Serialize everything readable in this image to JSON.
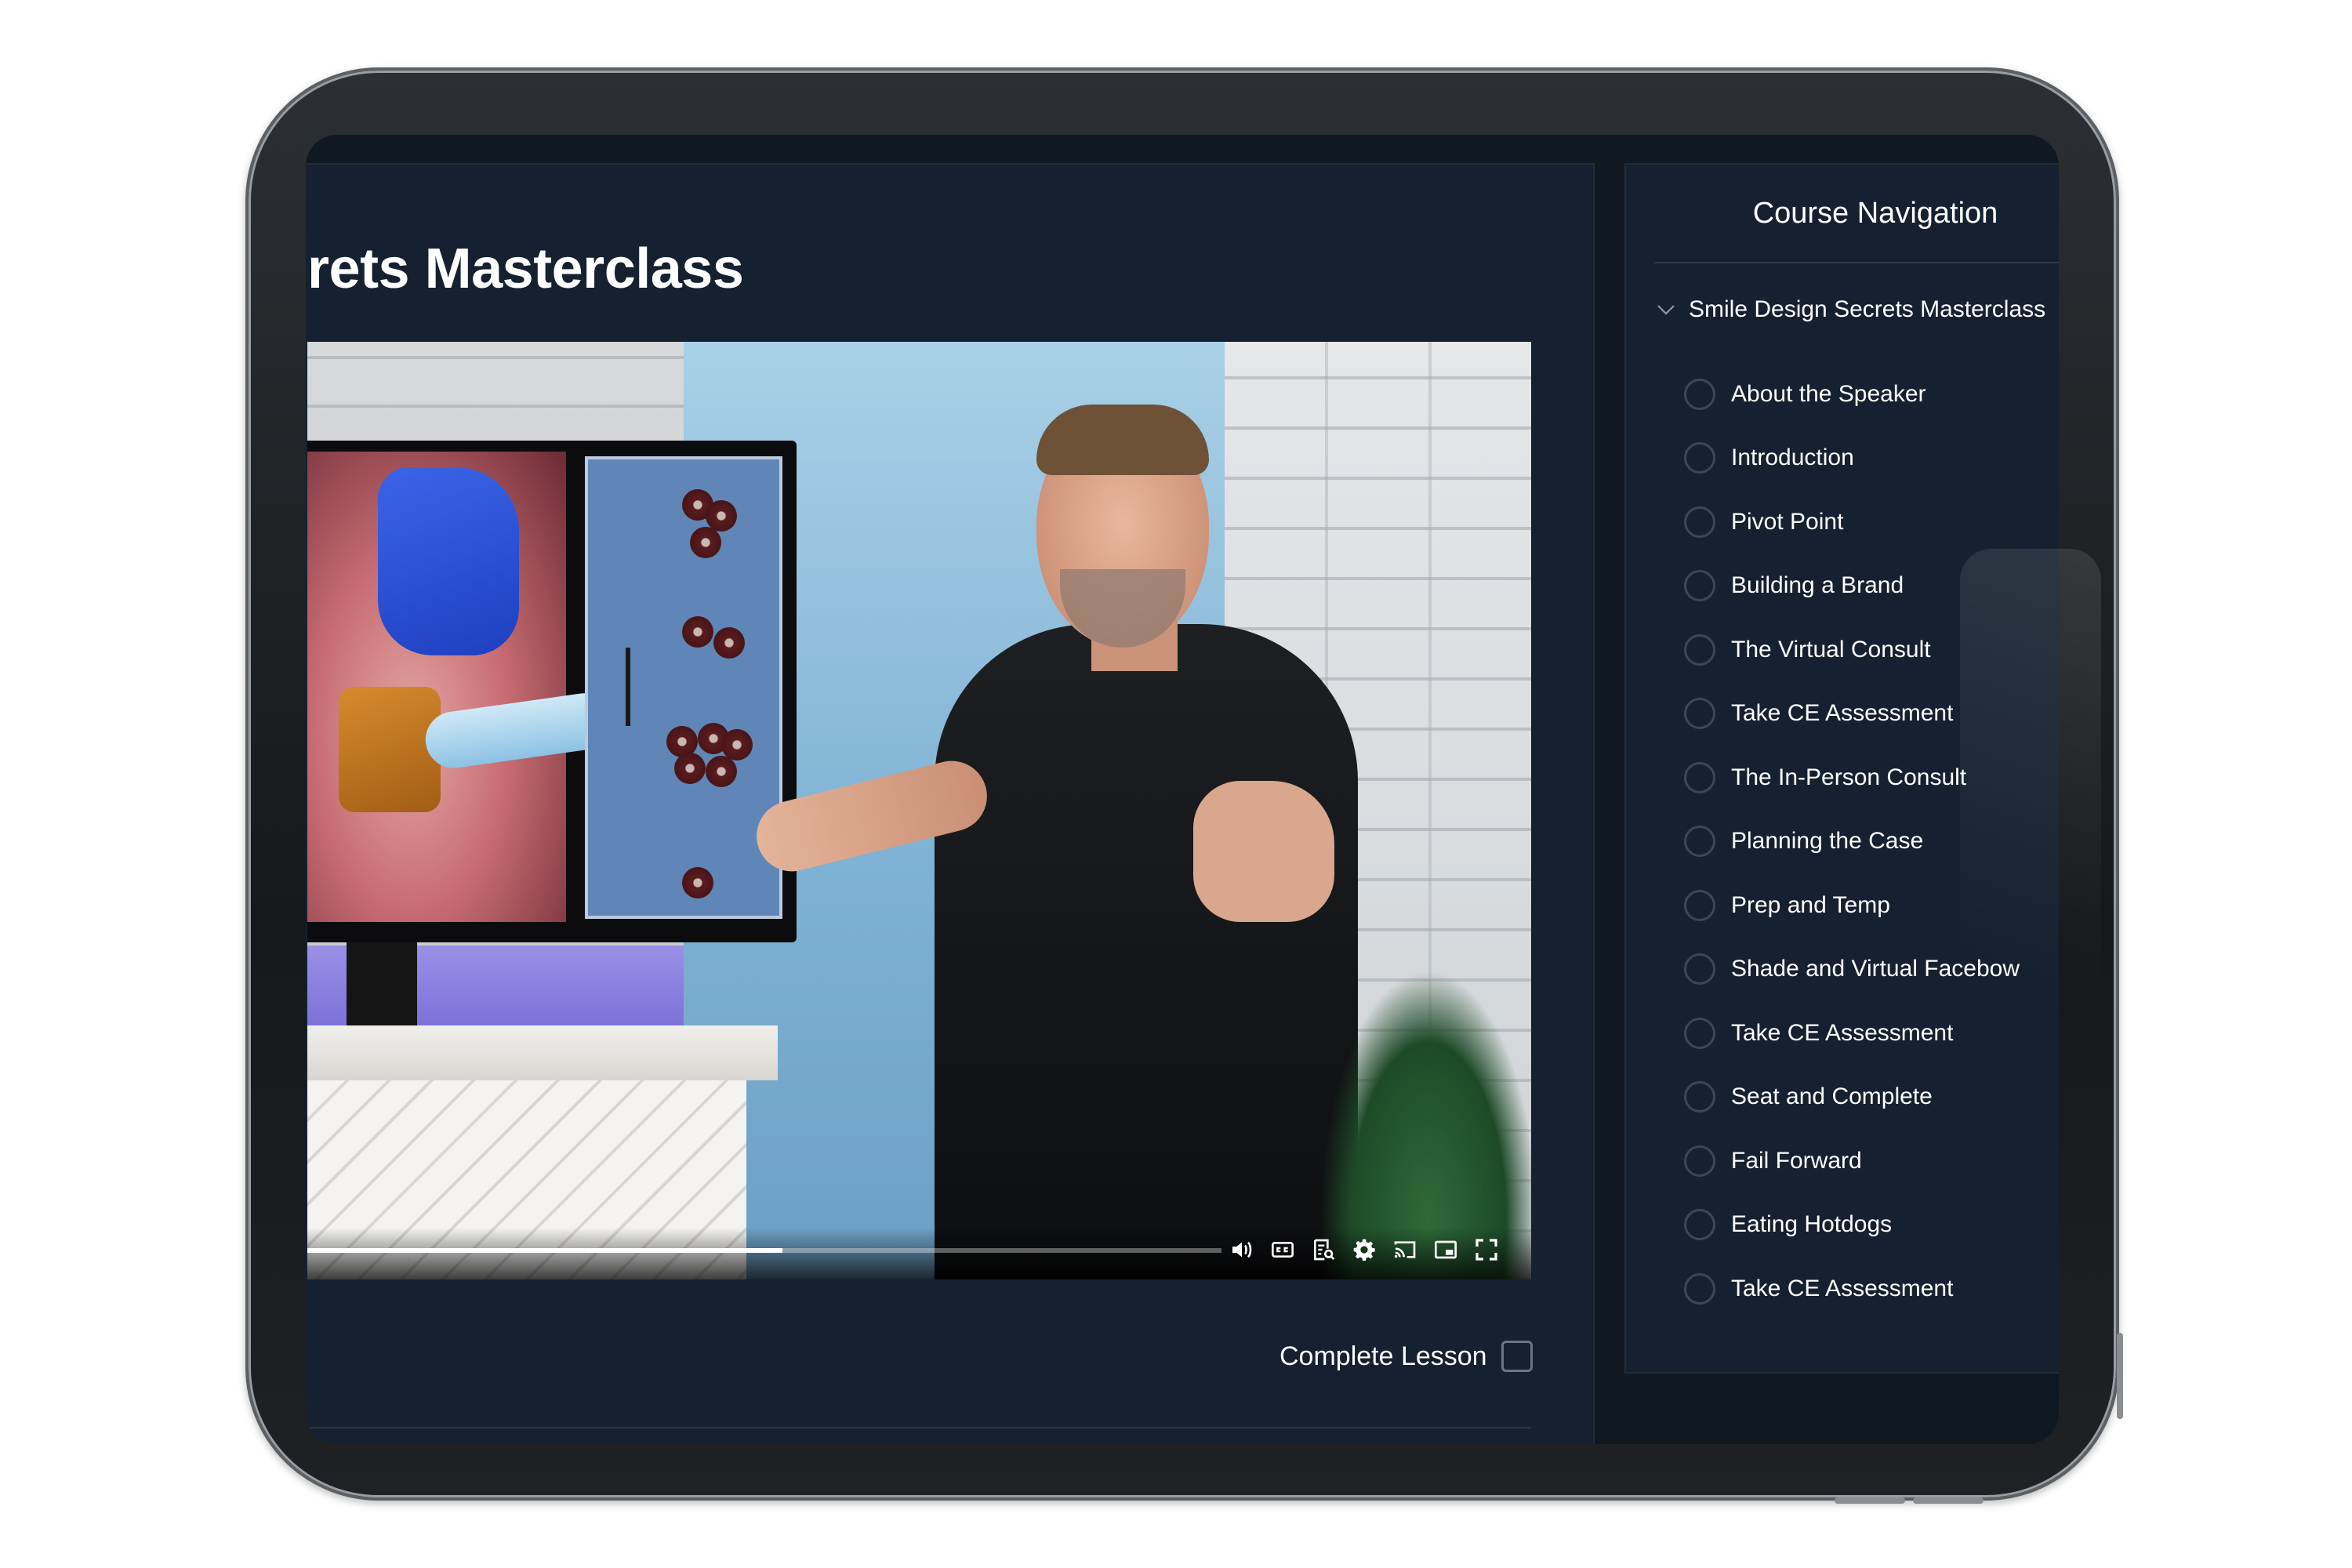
{
  "page": {
    "title": "rets Masterclass"
  },
  "video": {
    "progress_fraction": 0.52,
    "controls": [
      {
        "name": "volume-icon"
      },
      {
        "name": "captions-icon"
      },
      {
        "name": "transcript-icon"
      },
      {
        "name": "settings-icon"
      },
      {
        "name": "cast-icon"
      },
      {
        "name": "picture-in-picture-icon"
      },
      {
        "name": "fullscreen-icon"
      }
    ]
  },
  "lesson": {
    "complete_label": "Complete Lesson"
  },
  "nav": {
    "title": "Course Navigation",
    "section_label": "Smile Design Secrets Masterclass",
    "items": [
      {
        "label": "About the Speaker"
      },
      {
        "label": "Introduction"
      },
      {
        "label": "Pivot Point"
      },
      {
        "label": "Building a Brand"
      },
      {
        "label": "The Virtual Consult"
      },
      {
        "label": "Take CE Assessment"
      },
      {
        "label": "The In-Person Consult"
      },
      {
        "label": "Planning the Case"
      },
      {
        "label": "Prep and Temp"
      },
      {
        "label": "Shade and Virtual Facebow"
      },
      {
        "label": "Take CE Assessment"
      },
      {
        "label": "Seat and Complete"
      },
      {
        "label": "Fail Forward"
      },
      {
        "label": "Eating Hotdogs"
      },
      {
        "label": "Take CE Assessment"
      }
    ]
  },
  "colors": {
    "background": "#101822",
    "panel": "#152130",
    "text": "#ffffff",
    "radio_border": "#3a4858"
  }
}
